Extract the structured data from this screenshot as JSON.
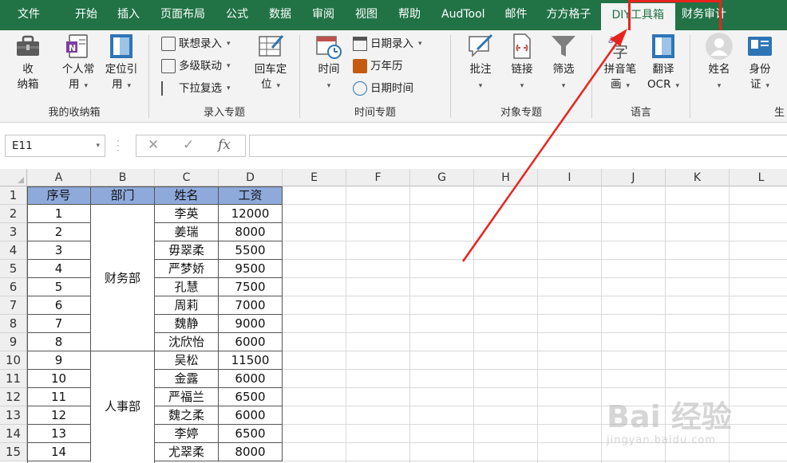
{
  "menu": {
    "tabs": [
      "文件",
      "开始",
      "插入",
      "页面布局",
      "公式",
      "数据",
      "审阅",
      "视图",
      "帮助",
      "AudTool",
      "邮件",
      "方方格子",
      "DIY工具箱",
      "财务审计"
    ],
    "active": "DIY工具箱"
  },
  "ribbon": {
    "groups": {
      "my_box": "我的收纳箱",
      "entry": "录入专题",
      "time": "时间专题",
      "object": "对象专题",
      "language": "语言",
      "partial": "生"
    },
    "buttons": {
      "storage": [
        "收",
        "纳箱"
      ],
      "personal": [
        "个人常",
        "用"
      ],
      "locate": [
        "定位引",
        "用"
      ],
      "assoc_entry": "联想录入",
      "multilevel": "多级联动",
      "dropdown_multi": "下拉复选",
      "enter_locate": [
        "回车定",
        "位"
      ],
      "time": "时间",
      "date_entry": "日期录入",
      "calendar": "万年历",
      "datetime": "日期时间",
      "comment": "批注",
      "link": "链接",
      "filter": "筛选",
      "pinyin": [
        "拼音笔",
        "画"
      ],
      "translate": [
        "翻译",
        "OCR"
      ],
      "name": "姓名",
      "id": [
        "身份",
        "证"
      ]
    }
  },
  "formula_bar": {
    "name_box": "E11",
    "cancel": "✕",
    "confirm": "✓",
    "fx": "fx",
    "value": ""
  },
  "sheet": {
    "columns": [
      "A",
      "B",
      "C",
      "D",
      "E",
      "F",
      "G",
      "H",
      "I",
      "J",
      "K",
      "L"
    ],
    "rows": [
      "1",
      "2",
      "3",
      "4",
      "5",
      "6",
      "7",
      "8",
      "9",
      "10",
      "11",
      "12",
      "13",
      "14",
      "15"
    ],
    "header": [
      "序号",
      "部门",
      "姓名",
      "工资"
    ],
    "depts": [
      "财务部",
      "人事部"
    ],
    "data": [
      [
        "1",
        "李英",
        "12000"
      ],
      [
        "2",
        "姜瑞",
        "8000"
      ],
      [
        "3",
        "毋翠柔",
        "5500"
      ],
      [
        "4",
        "严梦娇",
        "9500"
      ],
      [
        "5",
        "孔慧",
        "7500"
      ],
      [
        "6",
        "周莉",
        "7000"
      ],
      [
        "7",
        "魏静",
        "9000"
      ],
      [
        "8",
        "沈欣怡",
        "6000"
      ],
      [
        "9",
        "吴松",
        "11500"
      ],
      [
        "10",
        "金露",
        "6000"
      ],
      [
        "11",
        "严福兰",
        "6500"
      ],
      [
        "12",
        "魏之柔",
        "6000"
      ],
      [
        "13",
        "李婷",
        "6500"
      ],
      [
        "14",
        "尤翠柔",
        "8000"
      ]
    ]
  },
  "watermark": {
    "main": "Bai 经验",
    "sub": "jingyan.baidu.com"
  }
}
